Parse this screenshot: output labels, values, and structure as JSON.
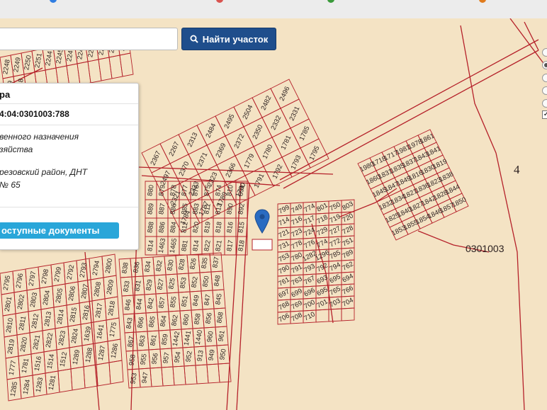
{
  "search": {
    "placeholder": "",
    "value": "",
    "button_label": "Найти участок",
    "button_icon": "search-icon"
  },
  "info_panel": {
    "title_fragment": "ра",
    "cadastral_number": "4:04:0301003:788",
    "purpose_line1": "венного назначения",
    "purpose_line2": "зяйства",
    "address_line1": "резовский район, ДНТ",
    "address_line2": "№ 65",
    "docs_button": "оступные документы"
  },
  "map": {
    "quarter_label": "0301003",
    "zone_label": "4",
    "selected_plot": "788",
    "marker_icon": "map-pin-icon",
    "colors": {
      "background": "#f4e3c4",
      "parcel_border": "#b5212a",
      "marker": "#2a6bc1"
    },
    "plot_labels": {
      "a1": [
        "1980",
        "1718",
        "1717",
        "1981",
        "1978",
        "1861",
        "1860",
        "1831",
        "1835",
        "1837",
        "1843",
        "1841",
        "1845",
        "1847",
        "1849",
        "1816",
        "1830",
        "1819",
        "1832",
        "1834",
        "1821",
        "1836",
        "1823",
        "1838",
        "1825",
        "1840",
        "1827",
        "1842",
        "1828",
        "1844",
        "1853",
        "1855",
        "1854",
        "1846",
        "1857",
        "1850"
      ],
      "a2": [
        "2367",
        "2267",
        "2313",
        "2484",
        "2495",
        "2504",
        "2482",
        "2496",
        "2497",
        "2370",
        "2371",
        "2369",
        "2372",
        "2350",
        "2332",
        "2331",
        "2321",
        "2333",
        "2323",
        "2366",
        "1779",
        "1780",
        "1781",
        "1785",
        "1784",
        "1787",
        "1789",
        "1790",
        "1791",
        "1792",
        "1793",
        "1795"
      ],
      "a3": [
        "880",
        "879",
        "878",
        "877",
        "876",
        "875",
        "874",
        "810",
        "891",
        "889",
        "887",
        "886",
        "885",
        "883",
        "811",
        "813",
        "890",
        "892",
        "888",
        "886",
        "884",
        "812",
        "820",
        "819",
        "818",
        "816",
        "815",
        "814",
        "1463",
        "1465",
        "881",
        "814",
        "822",
        "821",
        "817",
        "818"
      ],
      "a4": [
        "799",
        "749",
        "774",
        "801",
        "750",
        "803",
        "714",
        "716",
        "717",
        "718",
        "719",
        "720",
        "721",
        "723",
        "724",
        "729",
        "727",
        "728",
        "731",
        "778",
        "776",
        "774",
        "772",
        "751",
        "753",
        "780",
        "1282",
        "1296",
        "785",
        "789",
        "790",
        "791",
        "793",
        "792",
        "794",
        "762",
        "761",
        "763",
        "767",
        "693",
        "695",
        "694",
        "697",
        "699",
        "696",
        "695",
        "765",
        "766",
        "768",
        "769",
        "700",
        "701",
        "703",
        "704",
        "706",
        "708",
        "710"
      ],
      "a5": [
        "838",
        "836",
        "834",
        "832",
        "830",
        "828",
        "826",
        "835",
        "837",
        "833",
        "831",
        "829",
        "827",
        "825",
        "853",
        "852",
        "850",
        "848",
        "846",
        "844",
        "842",
        "857",
        "855",
        "851",
        "849",
        "847",
        "845",
        "843",
        "866",
        "865",
        "864",
        "862",
        "860",
        "858",
        "856",
        "868",
        "867",
        "863",
        "861",
        "859",
        "1442",
        "1441",
        "1440",
        "960",
        "961",
        "958",
        "955",
        "956",
        "957",
        "954",
        "952",
        "913",
        "949",
        "950",
        "953",
        "947"
      ],
      "a6": [
        "2795",
        "2796",
        "2797",
        "2798",
        "2799",
        "2792",
        "2793",
        "2794",
        "2800",
        "2801",
        "2802",
        "2803",
        "2804",
        "2805",
        "2806",
        "2807",
        "2808",
        "2809",
        "2810",
        "2811",
        "2812",
        "2813",
        "2814",
        "2815",
        "2816",
        "2817",
        "2818",
        "2819",
        "2820",
        "2821",
        "2822",
        "2823",
        "2824",
        "1639",
        "1641",
        "1775",
        "1777",
        "1781",
        "1516",
        "1514",
        "1512",
        "1289",
        "1288",
        "1287",
        "1286",
        "1285",
        "1284",
        "1283",
        "1281"
      ],
      "a7": [
        "2248",
        "2249",
        "2250",
        "2251",
        "2244",
        "2245",
        "2246",
        "2247",
        "2240",
        "2241",
        "2242",
        "2243",
        "2239",
        "1718"
      ]
    }
  }
}
